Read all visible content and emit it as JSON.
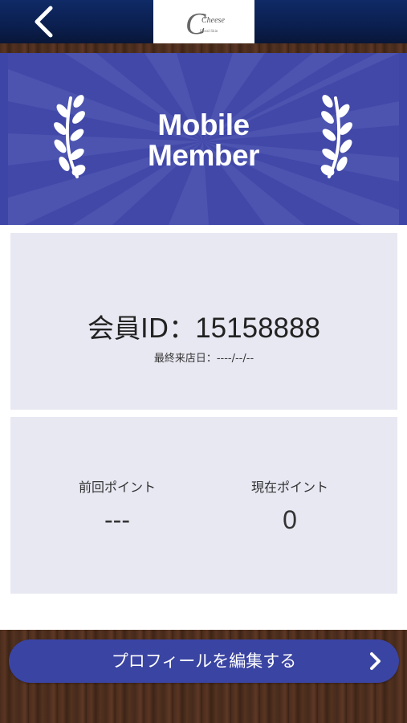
{
  "header": {
    "logo_text": "Cheese",
    "logo_subtext": "Floral Skin"
  },
  "banner": {
    "title_line1": "Mobile",
    "title_line2": "Member"
  },
  "member": {
    "id_label": "会員ID：",
    "id_value": "15158888",
    "last_visit": "最終来店日：----/--/--"
  },
  "points": {
    "previous_label": "前回ポイント",
    "previous_value": "---",
    "current_label": "現在ポイント",
    "current_value": "0"
  },
  "actions": {
    "edit_profile_label": "プロフィールを編集する"
  },
  "colors": {
    "header": "#0b1f4f",
    "banner": "#4148a8",
    "card": "#e8e8f3",
    "button": "#3a44a2"
  }
}
